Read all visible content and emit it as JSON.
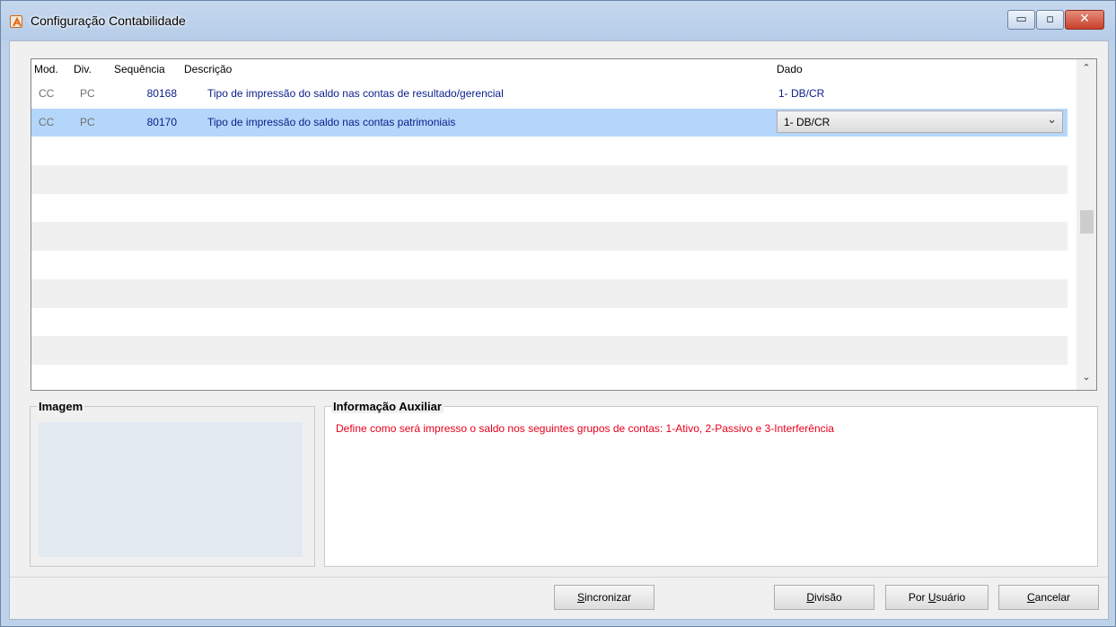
{
  "window": {
    "title": "Configuração Contabilidade",
    "minimize_glyph": "▭",
    "restore_glyph": "▫",
    "close_glyph": "✕"
  },
  "grid": {
    "columns": {
      "mod": "Mod.",
      "div": "Div.",
      "seq": "Sequência",
      "desc": "Descrição",
      "dado": "Dado"
    },
    "rows": [
      {
        "mod": "CC",
        "div": "PC",
        "seq": "80168",
        "desc": "Tipo de impressão do saldo nas contas de resultado/gerencial",
        "dado": "1- DB/CR"
      },
      {
        "mod": "CC",
        "div": "PC",
        "seq": "80170",
        "desc": "Tipo de impressão do saldo nas contas patrimoniais",
        "dado": "1- DB/CR"
      }
    ],
    "scroll_up": "⌃",
    "scroll_down": "⌄",
    "combo_chevron": "⌄"
  },
  "image_group": {
    "title": "Imagem"
  },
  "aux_group": {
    "title": "Informação Auxiliar",
    "text": "Define como será impresso o saldo nos seguintes grupos de contas: 1-Ativo, 2-Passivo e 3-Interferência"
  },
  "buttons": {
    "sync_first": "S",
    "sync_rest": "incronizar",
    "div_first": "D",
    "div_rest": "ivisão",
    "user_pre": "Por ",
    "user_u": "U",
    "user_rest": "suário",
    "cancel_first": "C",
    "cancel_rest": "ancelar"
  },
  "colors": {
    "selected_row": "#b4d6fa",
    "data_text": "#0b1e8a",
    "aux_text": "#e8001c"
  },
  "icons": {
    "app": "app-logo-icon"
  }
}
